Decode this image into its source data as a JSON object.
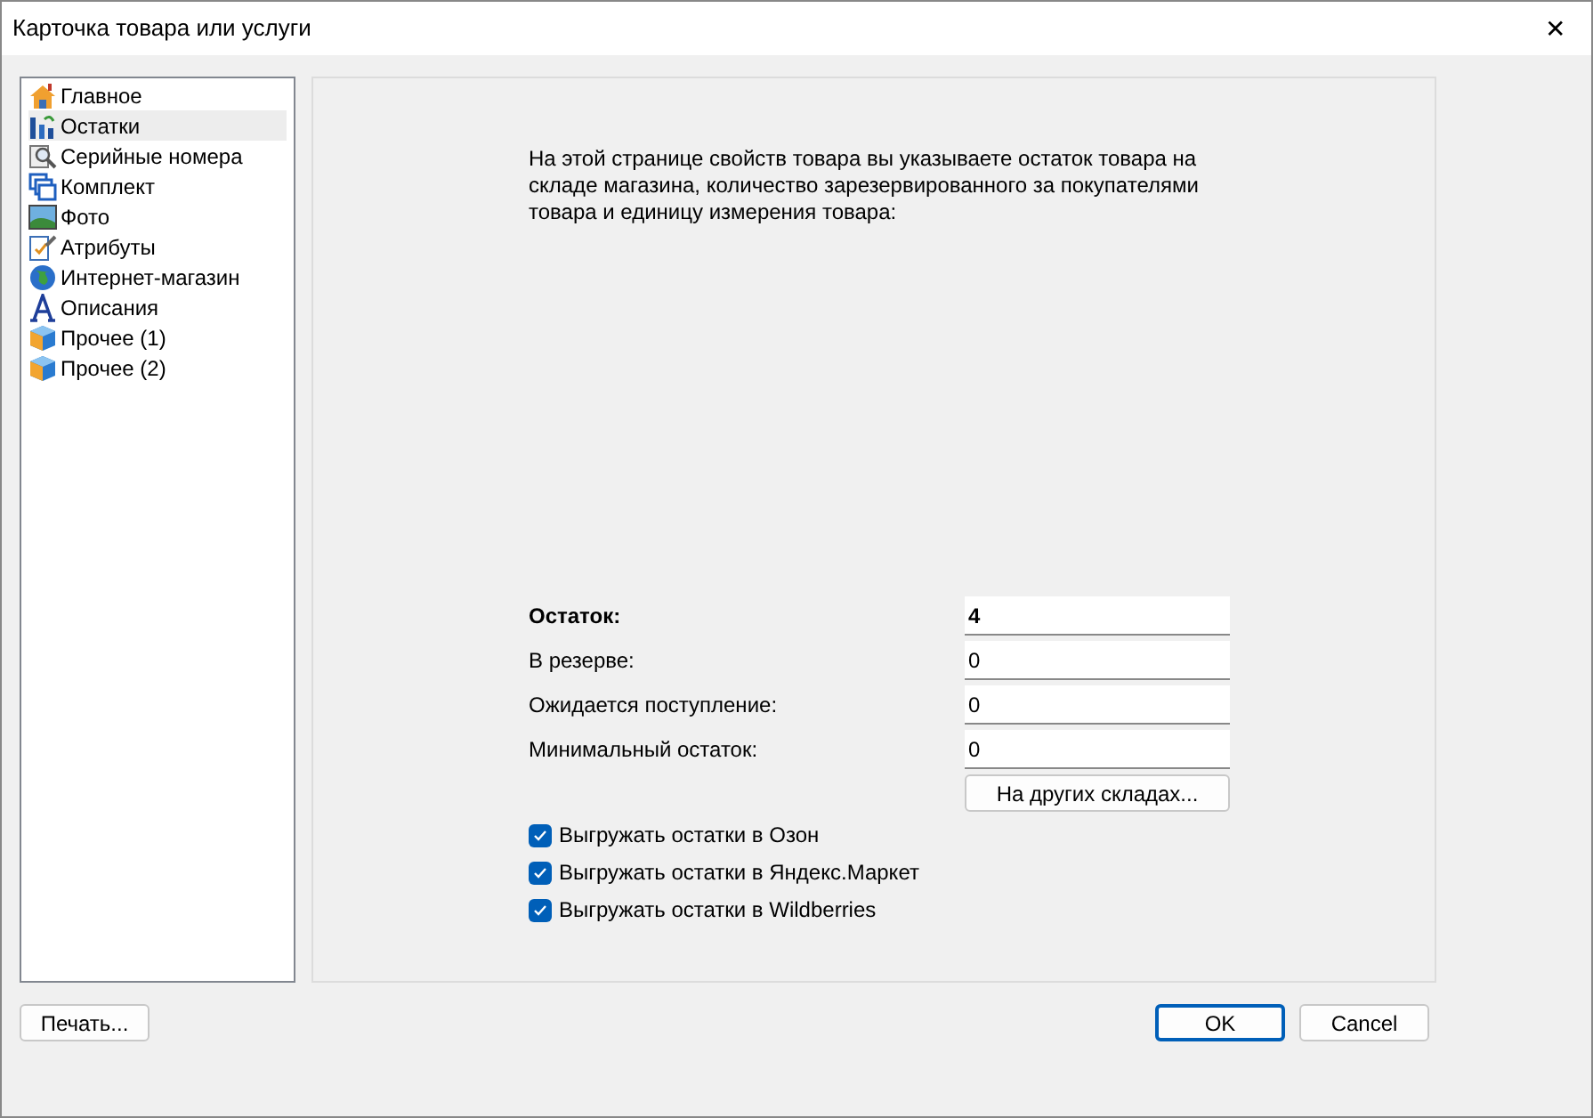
{
  "window": {
    "title": "Карточка товара или услуги",
    "close": "✕"
  },
  "sidebar": {
    "items": [
      {
        "label": "Главное",
        "selected": false
      },
      {
        "label": "Остатки",
        "selected": true
      },
      {
        "label": "Серийные номера",
        "selected": false
      },
      {
        "label": "Комплект",
        "selected": false
      },
      {
        "label": "Фото",
        "selected": false
      },
      {
        "label": "Атрибуты",
        "selected": false
      },
      {
        "label": "Интернет-магазин",
        "selected": false
      },
      {
        "label": "Описания",
        "selected": false
      },
      {
        "label": "Прочее (1)",
        "selected": false
      },
      {
        "label": "Прочее (2)",
        "selected": false
      }
    ]
  },
  "description": "На этой странице свойств товара вы указываете остаток товара на складе магазина, количество зарезервированного за покупателями товара и единицу измерения товара:",
  "fields": [
    {
      "label": "Остаток:",
      "value": "4",
      "bold": true
    },
    {
      "label": "В резерве:",
      "value": "0",
      "bold": false
    },
    {
      "label": "Ожидается поступление:",
      "value": "0",
      "bold": false
    },
    {
      "label": "Минимальный остаток:",
      "value": "0",
      "bold": false
    }
  ],
  "other_warehouses_button": "На других складах...",
  "checkboxes": [
    {
      "label": "Выгружать остатки в Озон",
      "checked": true
    },
    {
      "label": "Выгружать остатки в Яндекс.Маркет",
      "checked": true
    },
    {
      "label": "Выгружать остатки в Wildberries",
      "checked": true
    }
  ],
  "buttons": {
    "print": "Печать...",
    "ok": "OK",
    "cancel": "Cancel"
  }
}
